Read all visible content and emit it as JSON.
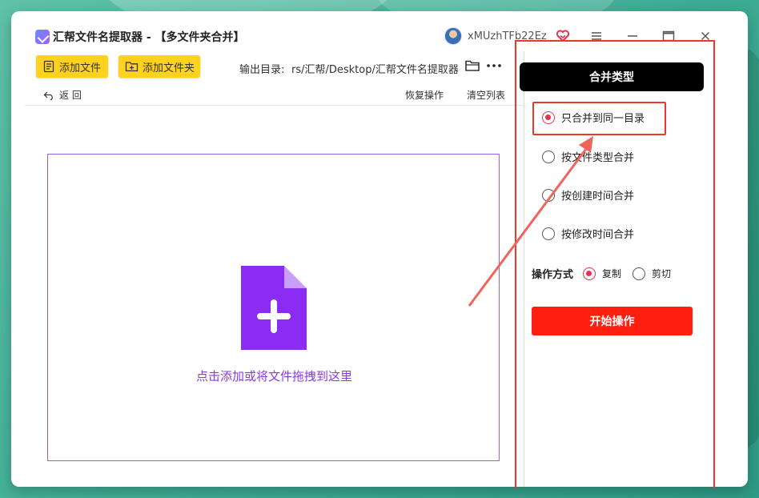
{
  "window": {
    "title": "汇帮文件名提取器 - 【多文件夹合并】",
    "user": "xMUzhTFb22Ez"
  },
  "toolbar": {
    "add_file_label": "添加文件",
    "add_folder_label": "添加文件夹",
    "output_label": "输出目录:",
    "output_path": "rs/汇帮/Desktop/汇帮文件名提取器"
  },
  "nav": {
    "back_label": "返 回",
    "restore_label": "恢复操作",
    "clear_label": "清空列表"
  },
  "dropzone": {
    "text": "点击添加或将文件拖拽到这里"
  },
  "panel": {
    "header": "合并类型",
    "options": [
      {
        "label": "只合并到同一目录",
        "checked": true
      },
      {
        "label": "按文件类型合并",
        "checked": false
      },
      {
        "label": "按创建时间合并",
        "checked": false
      },
      {
        "label": "按修改时间合并",
        "checked": false
      }
    ],
    "op_label": "操作方式",
    "op_options": [
      {
        "label": "复制",
        "checked": true
      },
      {
        "label": "剪切",
        "checked": false
      }
    ],
    "start_label": "开始操作"
  },
  "colors": {
    "accent_purple": "#8a3ae0",
    "toolbar_yellow": "#ffd21f",
    "start_red": "#ff1f10",
    "annotation_red": "#e8392f",
    "radio_red": "#e8324a"
  },
  "icons": {
    "logo": "app-logo-icon",
    "add_file": "file-list-icon",
    "add_folder": "folder-plus-icon",
    "folder": "folder-icon",
    "more": "more-icon",
    "back": "back-arrow-icon",
    "add_doc": "add-document-icon",
    "vip": "heart-badge-icon"
  }
}
